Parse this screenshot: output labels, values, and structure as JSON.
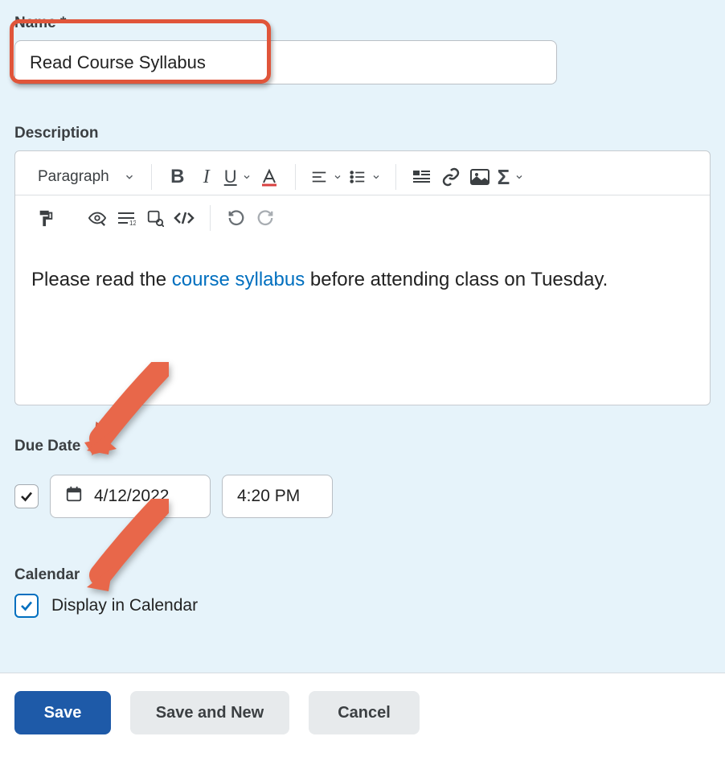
{
  "name_field": {
    "label": "Name *",
    "value": "Read Course Syllabus"
  },
  "description_field": {
    "label": "Description",
    "paragraph_selector": "Paragraph",
    "content_prefix": "Please read the ",
    "content_link": "course syllabus",
    "content_suffix": " before attending class on Tuesday."
  },
  "due_date": {
    "label": "Due Date",
    "enabled": true,
    "date": "4/12/2022",
    "time": "4:20 PM"
  },
  "calendar": {
    "label": "Calendar",
    "checkbox_label": "Display in Calendar",
    "checked": true
  },
  "buttons": {
    "save": "Save",
    "save_new": "Save and New",
    "cancel": "Cancel"
  },
  "colors": {
    "highlight": "#e0553a",
    "primary": "#1e5aa8",
    "link": "#006fbf"
  }
}
